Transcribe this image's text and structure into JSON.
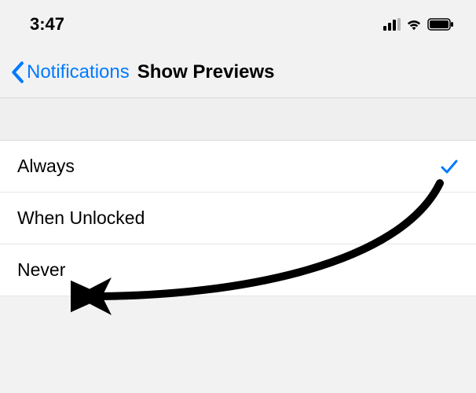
{
  "status_bar": {
    "time": "3:47"
  },
  "nav": {
    "back_label": "Notifications",
    "title": "Show Previews"
  },
  "options": {
    "items": [
      {
        "label": "Always",
        "selected": true
      },
      {
        "label": "When Unlocked",
        "selected": false
      },
      {
        "label": "Never",
        "selected": false
      }
    ]
  }
}
